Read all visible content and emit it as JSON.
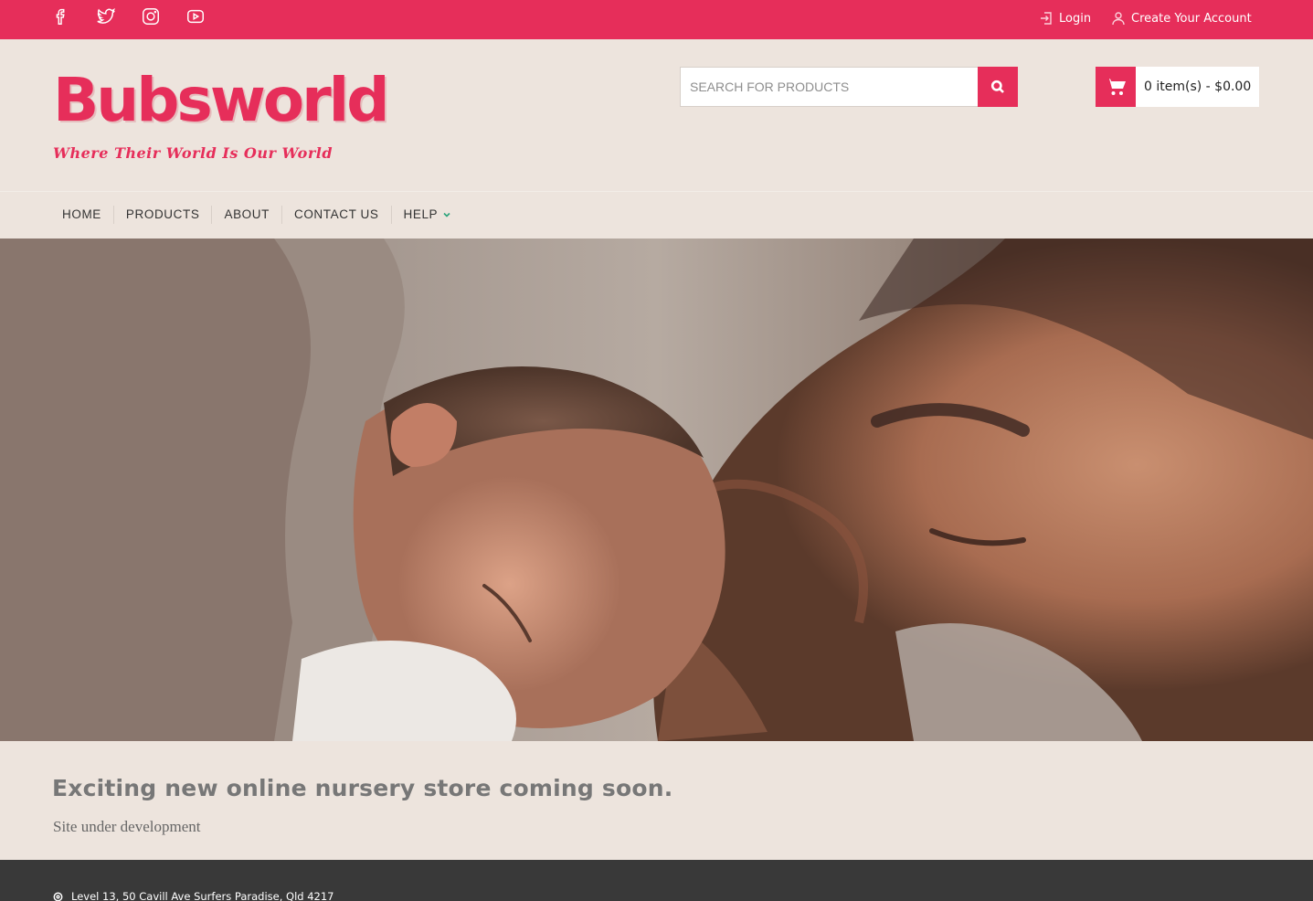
{
  "topbar": {
    "social": [
      "facebook-icon",
      "twitter-icon",
      "instagram-icon",
      "youtube-icon"
    ],
    "login_label": "Login",
    "create_account_label": "Create Your Account"
  },
  "brand": {
    "logo_text": "Bubsworld",
    "tagline": "Where Their World Is Our World",
    "accent_color": "#e62e5a"
  },
  "search": {
    "placeholder": "SEARCH FOR PRODUCTS"
  },
  "cart": {
    "summary": "0 item(s) - $0.00"
  },
  "nav": {
    "items": [
      "HOME",
      "PRODUCTS",
      "ABOUT",
      "CONTACT US",
      "HELP"
    ]
  },
  "main": {
    "headline": "Exciting new online nursery store coming soon.",
    "subline": "Site under development"
  },
  "footer": {
    "address": "Level 13, 50 Cavill Ave Surfers Paradise, Qld 4217"
  }
}
